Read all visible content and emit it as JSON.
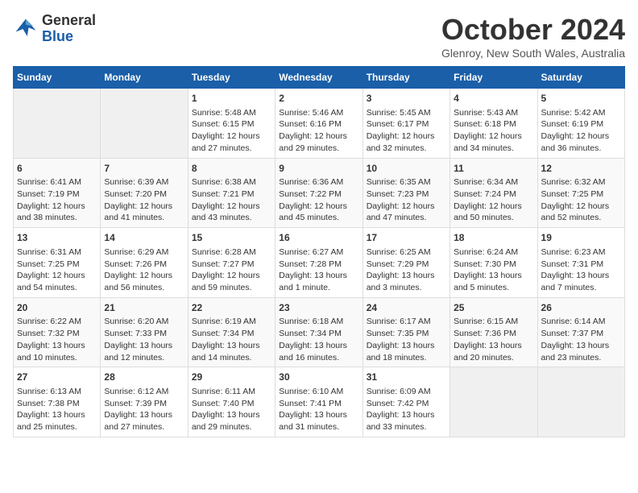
{
  "logo": {
    "general": "General",
    "blue": "Blue"
  },
  "title": "October 2024",
  "location": "Glenroy, New South Wales, Australia",
  "days_of_week": [
    "Sunday",
    "Monday",
    "Tuesday",
    "Wednesday",
    "Thursday",
    "Friday",
    "Saturday"
  ],
  "weeks": [
    [
      {
        "day": "",
        "info": ""
      },
      {
        "day": "",
        "info": ""
      },
      {
        "day": "1",
        "info": "Sunrise: 5:48 AM\nSunset: 6:15 PM\nDaylight: 12 hours\nand 27 minutes."
      },
      {
        "day": "2",
        "info": "Sunrise: 5:46 AM\nSunset: 6:16 PM\nDaylight: 12 hours\nand 29 minutes."
      },
      {
        "day": "3",
        "info": "Sunrise: 5:45 AM\nSunset: 6:17 PM\nDaylight: 12 hours\nand 32 minutes."
      },
      {
        "day": "4",
        "info": "Sunrise: 5:43 AM\nSunset: 6:18 PM\nDaylight: 12 hours\nand 34 minutes."
      },
      {
        "day": "5",
        "info": "Sunrise: 5:42 AM\nSunset: 6:19 PM\nDaylight: 12 hours\nand 36 minutes."
      }
    ],
    [
      {
        "day": "6",
        "info": "Sunrise: 6:41 AM\nSunset: 7:19 PM\nDaylight: 12 hours\nand 38 minutes."
      },
      {
        "day": "7",
        "info": "Sunrise: 6:39 AM\nSunset: 7:20 PM\nDaylight: 12 hours\nand 41 minutes."
      },
      {
        "day": "8",
        "info": "Sunrise: 6:38 AM\nSunset: 7:21 PM\nDaylight: 12 hours\nand 43 minutes."
      },
      {
        "day": "9",
        "info": "Sunrise: 6:36 AM\nSunset: 7:22 PM\nDaylight: 12 hours\nand 45 minutes."
      },
      {
        "day": "10",
        "info": "Sunrise: 6:35 AM\nSunset: 7:23 PM\nDaylight: 12 hours\nand 47 minutes."
      },
      {
        "day": "11",
        "info": "Sunrise: 6:34 AM\nSunset: 7:24 PM\nDaylight: 12 hours\nand 50 minutes."
      },
      {
        "day": "12",
        "info": "Sunrise: 6:32 AM\nSunset: 7:25 PM\nDaylight: 12 hours\nand 52 minutes."
      }
    ],
    [
      {
        "day": "13",
        "info": "Sunrise: 6:31 AM\nSunset: 7:25 PM\nDaylight: 12 hours\nand 54 minutes."
      },
      {
        "day": "14",
        "info": "Sunrise: 6:29 AM\nSunset: 7:26 PM\nDaylight: 12 hours\nand 56 minutes."
      },
      {
        "day": "15",
        "info": "Sunrise: 6:28 AM\nSunset: 7:27 PM\nDaylight: 12 hours\nand 59 minutes."
      },
      {
        "day": "16",
        "info": "Sunrise: 6:27 AM\nSunset: 7:28 PM\nDaylight: 13 hours\nand 1 minute."
      },
      {
        "day": "17",
        "info": "Sunrise: 6:25 AM\nSunset: 7:29 PM\nDaylight: 13 hours\nand 3 minutes."
      },
      {
        "day": "18",
        "info": "Sunrise: 6:24 AM\nSunset: 7:30 PM\nDaylight: 13 hours\nand 5 minutes."
      },
      {
        "day": "19",
        "info": "Sunrise: 6:23 AM\nSunset: 7:31 PM\nDaylight: 13 hours\nand 7 minutes."
      }
    ],
    [
      {
        "day": "20",
        "info": "Sunrise: 6:22 AM\nSunset: 7:32 PM\nDaylight: 13 hours\nand 10 minutes."
      },
      {
        "day": "21",
        "info": "Sunrise: 6:20 AM\nSunset: 7:33 PM\nDaylight: 13 hours\nand 12 minutes."
      },
      {
        "day": "22",
        "info": "Sunrise: 6:19 AM\nSunset: 7:34 PM\nDaylight: 13 hours\nand 14 minutes."
      },
      {
        "day": "23",
        "info": "Sunrise: 6:18 AM\nSunset: 7:34 PM\nDaylight: 13 hours\nand 16 minutes."
      },
      {
        "day": "24",
        "info": "Sunrise: 6:17 AM\nSunset: 7:35 PM\nDaylight: 13 hours\nand 18 minutes."
      },
      {
        "day": "25",
        "info": "Sunrise: 6:15 AM\nSunset: 7:36 PM\nDaylight: 13 hours\nand 20 minutes."
      },
      {
        "day": "26",
        "info": "Sunrise: 6:14 AM\nSunset: 7:37 PM\nDaylight: 13 hours\nand 23 minutes."
      }
    ],
    [
      {
        "day": "27",
        "info": "Sunrise: 6:13 AM\nSunset: 7:38 PM\nDaylight: 13 hours\nand 25 minutes."
      },
      {
        "day": "28",
        "info": "Sunrise: 6:12 AM\nSunset: 7:39 PM\nDaylight: 13 hours\nand 27 minutes."
      },
      {
        "day": "29",
        "info": "Sunrise: 6:11 AM\nSunset: 7:40 PM\nDaylight: 13 hours\nand 29 minutes."
      },
      {
        "day": "30",
        "info": "Sunrise: 6:10 AM\nSunset: 7:41 PM\nDaylight: 13 hours\nand 31 minutes."
      },
      {
        "day": "31",
        "info": "Sunrise: 6:09 AM\nSunset: 7:42 PM\nDaylight: 13 hours\nand 33 minutes."
      },
      {
        "day": "",
        "info": ""
      },
      {
        "day": "",
        "info": ""
      }
    ]
  ]
}
